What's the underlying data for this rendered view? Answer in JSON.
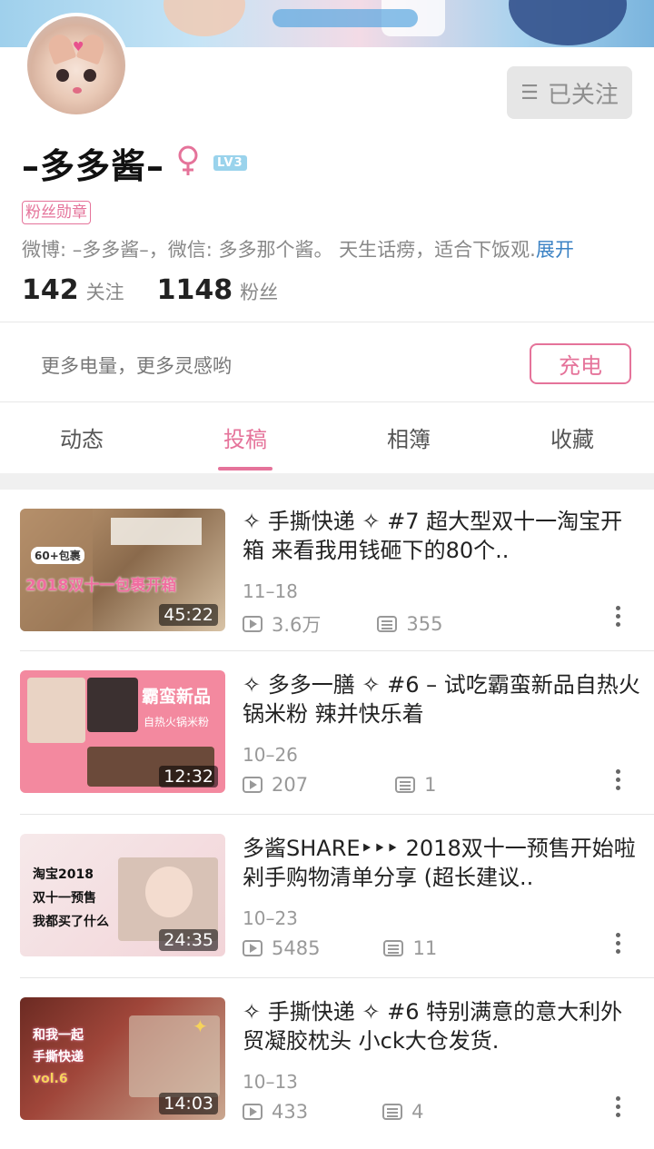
{
  "profile": {
    "name": "–多多酱–",
    "level": "LV3",
    "badge": "粉丝勋章",
    "bio": "微博: –多多酱–，微信: 多多那个酱。 天生话痨，适合下饭观.",
    "bio_more": "展开",
    "following_count": "142",
    "following_label": "关注",
    "followers_count": "1148",
    "followers_label": "粉丝",
    "follow_button": "已关注"
  },
  "charge": {
    "text": "更多电量，更多灵感哟",
    "button": "充电"
  },
  "tabs": [
    {
      "label": "动态"
    },
    {
      "label": "投稿"
    },
    {
      "label": "相簿"
    },
    {
      "label": "收藏"
    }
  ],
  "videos": [
    {
      "title": "✧ 手撕快递 ✧ #7 超大型双十一淘宝开箱 来看我用钱砸下的80个..",
      "date": "11–18",
      "views": "3.6万",
      "comments": "355",
      "duration": "45:22",
      "thumb_text": "2018双十一包裹开箱",
      "thumb_tag": "60+包裹"
    },
    {
      "title": "✧ 多多一膳 ✧ #6 – 试吃霸蛮新品自热火锅米粉 辣并快乐着",
      "date": "10–26",
      "views": "207",
      "comments": "1",
      "duration": "12:32",
      "thumb_text": "霸蛮新品",
      "thumb_sub": "自热火锅米粉"
    },
    {
      "title": "多酱SHARE‣‣‣ 2018双十一预售开始啦 剁手购物清单分享 (超长建议..",
      "date": "10–23",
      "views": "5485",
      "comments": "11",
      "duration": "24:35",
      "thumb_lines": [
        "淘宝2018",
        "双十一预售",
        "我都买了什么"
      ]
    },
    {
      "title": "✧ 手撕快递 ✧ #6 特别满意的意大利外贸凝胶枕头 小ck大仓发货.",
      "date": "10–13",
      "views": "433",
      "comments": "4",
      "duration": "14:03",
      "thumb_lines": [
        "和我一起",
        "手撕快递",
        "vol.6"
      ]
    }
  ]
}
